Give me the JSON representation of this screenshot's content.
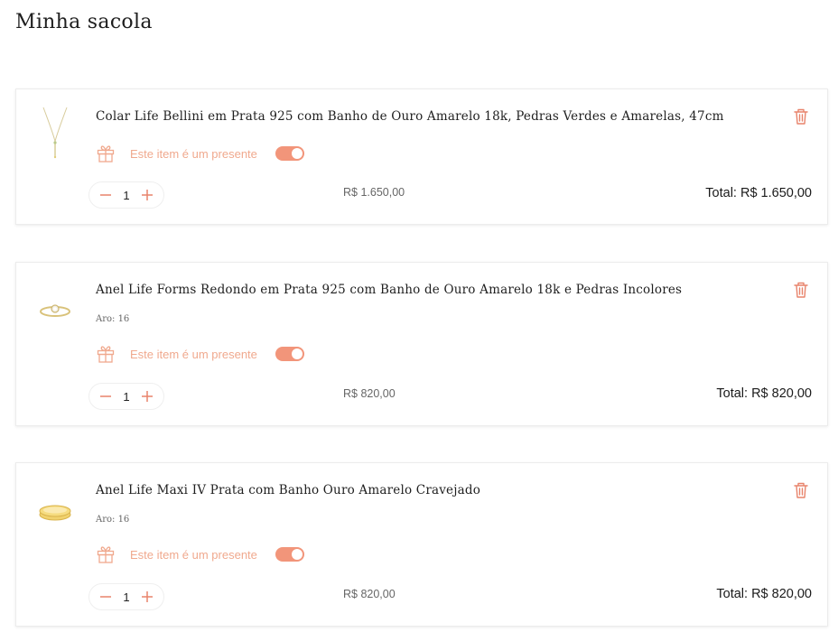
{
  "page": {
    "title": "Minha sacola"
  },
  "colors": {
    "accent": "#f2957a",
    "accent_light": "#f0a98e",
    "text": "#1f1f1f"
  },
  "items": [
    {
      "name": "Colar Life Bellini em Prata 925 com Banho de Ouro Amarelo 18k, Pedras Verdes e Amarelas, 47cm",
      "variant": "",
      "gift_label": "Este item é um presente",
      "gift_enabled": true,
      "quantity": "1",
      "unit_price": "R$ 1.650,00",
      "total": "Total: R$ 1.650,00",
      "thumb_icon": "necklace-thumbnail"
    },
    {
      "name": "Anel Life Forms Redondo em Prata 925 com Banho de Ouro Amarelo 18k e Pedras Incolores",
      "variant": "Aro: 16",
      "gift_label": "Este item é um presente",
      "gift_enabled": true,
      "quantity": "1",
      "unit_price": "R$ 820,00",
      "total": "Total: R$ 820,00",
      "thumb_icon": "ring-thumbnail"
    },
    {
      "name": "Anel Life Maxi IV Prata com Banho Ouro Amarelo Cravejado",
      "variant": "Aro: 16",
      "gift_label": "Este item é um presente",
      "gift_enabled": true,
      "quantity": "1",
      "unit_price": "R$ 820,00",
      "total": "Total: R$ 820,00",
      "thumb_icon": "ring-thumbnail"
    }
  ]
}
